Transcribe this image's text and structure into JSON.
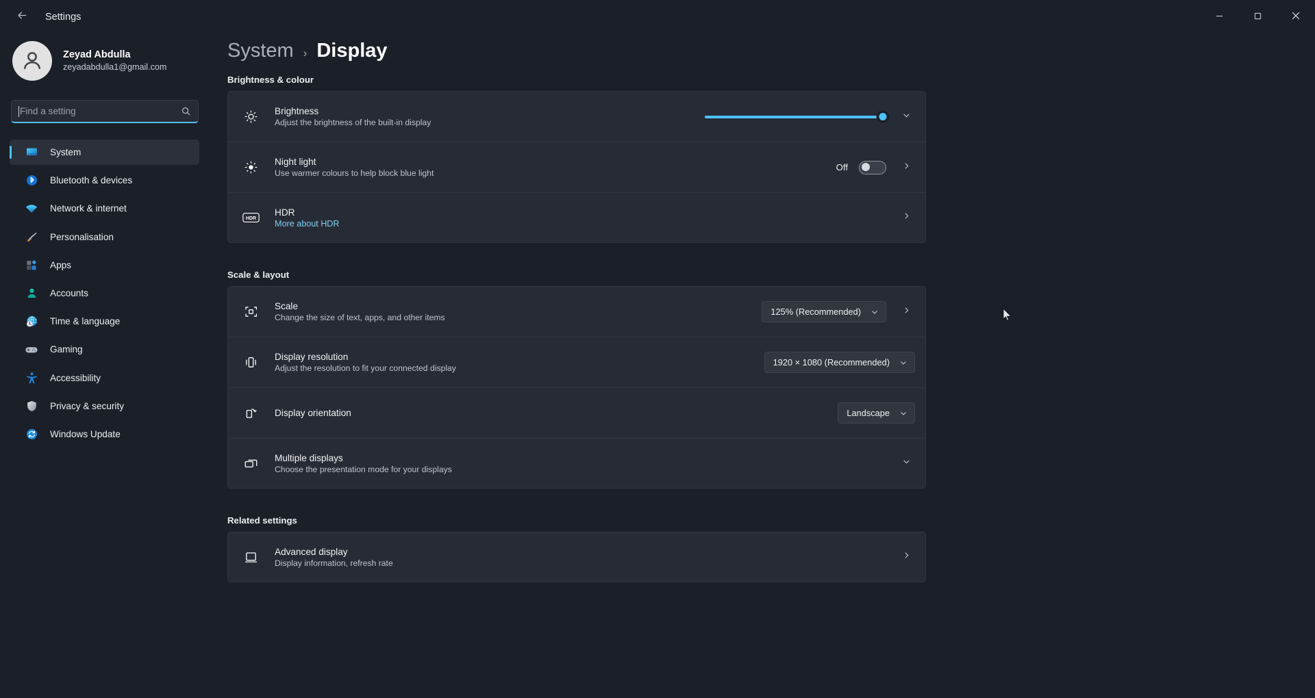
{
  "window": {
    "title": "Settings",
    "back_icon": "arrow-left-icon",
    "minimize_icon": "minimize-icon",
    "maximize_icon": "maximize-icon",
    "close_icon": "close-icon"
  },
  "account": {
    "name": "Zeyad Abdulla",
    "email": "zeyadabdulla1@gmail.com",
    "avatar_icon": "user-avatar-icon"
  },
  "search": {
    "placeholder": "Find a setting",
    "value": "",
    "icon": "search-icon"
  },
  "sidebar": {
    "items": [
      {
        "label": "System",
        "icon": "monitor-icon",
        "active": true
      },
      {
        "label": "Bluetooth & devices",
        "icon": "bluetooth-icon",
        "active": false
      },
      {
        "label": "Network & internet",
        "icon": "wifi-icon",
        "active": false
      },
      {
        "label": "Personalisation",
        "icon": "paintbrush-icon",
        "active": false
      },
      {
        "label": "Apps",
        "icon": "apps-icon",
        "active": false
      },
      {
        "label": "Accounts",
        "icon": "person-icon",
        "active": false
      },
      {
        "label": "Time & language",
        "icon": "clock-globe-icon",
        "active": false
      },
      {
        "label": "Gaming",
        "icon": "gamepad-icon",
        "active": false
      },
      {
        "label": "Accessibility",
        "icon": "accessibility-icon",
        "active": false
      },
      {
        "label": "Privacy & security",
        "icon": "shield-icon",
        "active": false
      },
      {
        "label": "Windows Update",
        "icon": "update-icon",
        "active": false
      }
    ]
  },
  "breadcrumb": {
    "root": "System",
    "separator": "›",
    "leaf": "Display"
  },
  "sections": {
    "brightness": {
      "title": "Brightness & colour",
      "brightness": {
        "title": "Brightness",
        "subtitle": "Adjust the brightness of the built-in display",
        "icon": "brightness-icon",
        "slider_percent": 98,
        "expand_icon": "chevron-down-icon"
      },
      "night_light": {
        "title": "Night light",
        "subtitle": "Use warmer colours to help block blue light",
        "icon": "night-light-icon",
        "toggle_label": "Off",
        "toggle_on": false,
        "chevron_icon": "chevron-right-icon"
      },
      "hdr": {
        "title": "HDR",
        "link": "More about HDR",
        "icon": "hdr-icon",
        "chevron_icon": "chevron-right-icon"
      }
    },
    "scale": {
      "title": "Scale & layout",
      "scale": {
        "title": "Scale",
        "subtitle": "Change the size of text, apps, and other items",
        "icon": "scale-icon",
        "value": "125% (Recommended)",
        "dropdown_icon": "chevron-down-icon",
        "chevron_icon": "chevron-right-icon"
      },
      "resolution": {
        "title": "Display resolution",
        "subtitle": "Adjust the resolution to fit your connected display",
        "icon": "resolution-icon",
        "value": "1920 × 1080 (Recommended)",
        "dropdown_icon": "chevron-down-icon"
      },
      "orientation": {
        "title": "Display orientation",
        "icon": "orientation-icon",
        "value": "Landscape",
        "dropdown_icon": "chevron-down-icon"
      },
      "multiple": {
        "title": "Multiple displays",
        "subtitle": "Choose the presentation mode for your displays",
        "icon": "multiple-displays-icon",
        "expand_icon": "chevron-down-icon"
      }
    },
    "related": {
      "title": "Related settings",
      "advanced": {
        "title": "Advanced display",
        "subtitle": "Display information, refresh rate",
        "icon": "advanced-display-icon",
        "chevron_icon": "chevron-right-icon"
      }
    }
  },
  "colors": {
    "accent": "#4cc2ff",
    "link": "#7cd0f5",
    "card_bg": "#272b35",
    "page_bg": "#1b1f28"
  }
}
